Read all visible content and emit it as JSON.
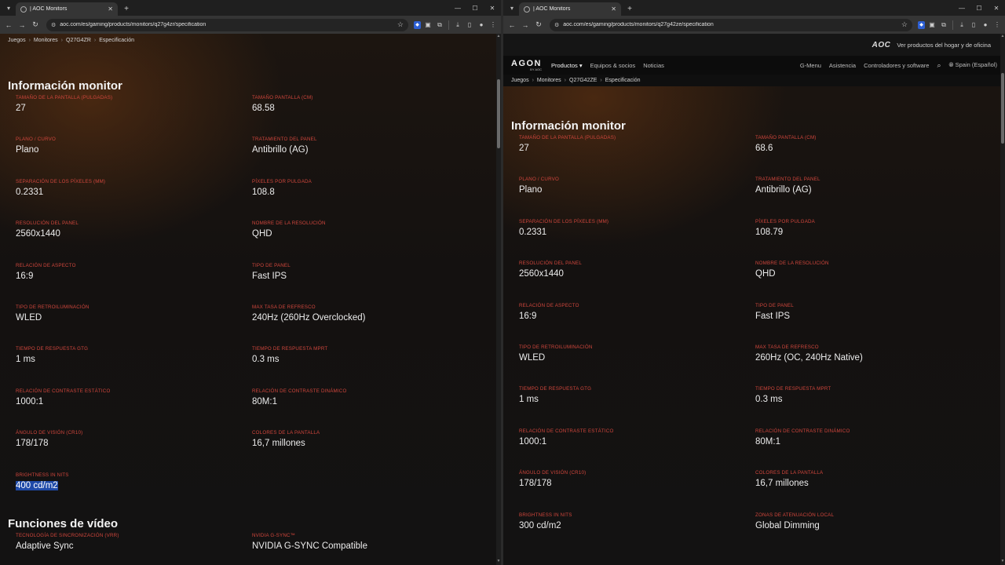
{
  "left": {
    "tab_title": "| AOC Monitors",
    "url": "aoc.com/es/gaming/products/monitors/q27g4zr/specification",
    "breadcrumb": [
      "Juegos",
      "Monitores",
      "Q27G4ZR",
      "Especificación"
    ],
    "section1_title": "Información monitor",
    "specs": [
      {
        "label": "Tamaño de la pantalla (pulgadas)",
        "value": "27"
      },
      {
        "label": "Tamaño pantalla (cm)",
        "value": "68.58"
      },
      {
        "label": "Plano / Curvo",
        "value": "Plano"
      },
      {
        "label": "Tratamiento del panel",
        "value": "Antibrillo (AG)"
      },
      {
        "label": "Separación de los píxeles (mm)",
        "value": "0.2331"
      },
      {
        "label": "Píxeles por pulgada",
        "value": "108.8"
      },
      {
        "label": "Resolución del panel",
        "value": "2560x1440"
      },
      {
        "label": "Nombre de la resolución",
        "value": "QHD"
      },
      {
        "label": "Relación de aspecto",
        "value": "16:9"
      },
      {
        "label": "Tipo de panel",
        "value": "Fast IPS"
      },
      {
        "label": "Tipo de retroiluminación",
        "value": "WLED"
      },
      {
        "label": "Max tasa de refresco",
        "value": "240Hz (260Hz Overclocked)"
      },
      {
        "label": "Tiempo de respuesta GtG",
        "value": "1 ms"
      },
      {
        "label": "Tiempo de respuesta MPRT",
        "value": "0.3 ms"
      },
      {
        "label": "Relación de contraste estático",
        "value": "1000:1"
      },
      {
        "label": "Relación de contraste dinámico",
        "value": "80M:1"
      },
      {
        "label": "Ángulo de visión (CR10)",
        "value": "178/178"
      },
      {
        "label": "Colores de la pantalla",
        "value": "16,7 millones"
      },
      {
        "label": "Brightness in nits",
        "value": "400 cd/m2"
      }
    ],
    "section2_title": "Funciones de vídeo",
    "video_specs": [
      {
        "label": "Tecnología de sincronización (VRR)",
        "value": "Adaptive Sync"
      },
      {
        "label": "NVIDIA G-SYNC™",
        "value": "NVIDIA G-SYNC Compatible"
      }
    ]
  },
  "right": {
    "tab_title": "| AOC Monitors",
    "url": "aoc.com/es/gaming/products/monitors/q27g42ze/specification",
    "util_logo": "AOC",
    "util_text": "Ver productos del hogar y de oficina",
    "agon_word": "AGON",
    "agon_by": "BY AOC",
    "nav": {
      "productos": "Productos",
      "equipos": "Equipos & socios",
      "noticias": "Noticias",
      "gmenu": "G-Menu",
      "asistencia": "Asistencia",
      "controladores": "Controladores y software",
      "region": "Spain (Español)"
    },
    "breadcrumb": [
      "Juegos",
      "Monitores",
      "Q27G42ZE",
      "Especificación"
    ],
    "section1_title": "Información monitor",
    "specs": [
      {
        "label": "Tamaño de la pantalla (pulgadas)",
        "value": "27"
      },
      {
        "label": "Tamaño pantalla (cm)",
        "value": "68.6"
      },
      {
        "label": "Plano / Curvo",
        "value": "Plano"
      },
      {
        "label": "Tratamiento del panel",
        "value": "Antibrillo (AG)"
      },
      {
        "label": "Separación de los píxeles (mm)",
        "value": "0.2331"
      },
      {
        "label": "Píxeles por pulgada",
        "value": "108.79"
      },
      {
        "label": "Resolución del panel",
        "value": "2560x1440"
      },
      {
        "label": "Nombre de la resolución",
        "value": "QHD"
      },
      {
        "label": "Relación de aspecto",
        "value": "16:9"
      },
      {
        "label": "Tipo de panel",
        "value": "Fast IPS"
      },
      {
        "label": "Tipo de retroiluminación",
        "value": "WLED"
      },
      {
        "label": "Max tasa de refresco",
        "value": "260Hz (OC, 240Hz Native)"
      },
      {
        "label": "Tiempo de respuesta GtG",
        "value": "1 ms"
      },
      {
        "label": "Tiempo de respuesta MPRT",
        "value": "0.3 ms"
      },
      {
        "label": "Relación de contraste estático",
        "value": "1000:1"
      },
      {
        "label": "Relación de contraste dinámico",
        "value": "80M:1"
      },
      {
        "label": "Ángulo de visión (CR10)",
        "value": "178/178"
      },
      {
        "label": "Colores de la pantalla",
        "value": "16,7 millones"
      },
      {
        "label": "Brightness in nits",
        "value": "300 cd/m2"
      },
      {
        "label": "Zonas de atenuación local",
        "value": "Global Dimming"
      }
    ]
  },
  "colors": {
    "label_red": "#d0463c",
    "selection_blue": "#1f4aa8",
    "ext_blue": "#2d5fd3"
  },
  "icons": {
    "tab_menu": "chevron-down-icon",
    "close": "close-icon",
    "new_tab": "plus-icon",
    "back": "arrow-left-icon",
    "forward": "arrow-right-icon",
    "reload": "reload-icon",
    "site_info": "tune-icon",
    "bookmark": "star-icon",
    "download": "download-icon",
    "profile": "avatar-icon",
    "menu": "kebab-menu-icon",
    "search": "search-icon",
    "globe": "globe-icon"
  }
}
